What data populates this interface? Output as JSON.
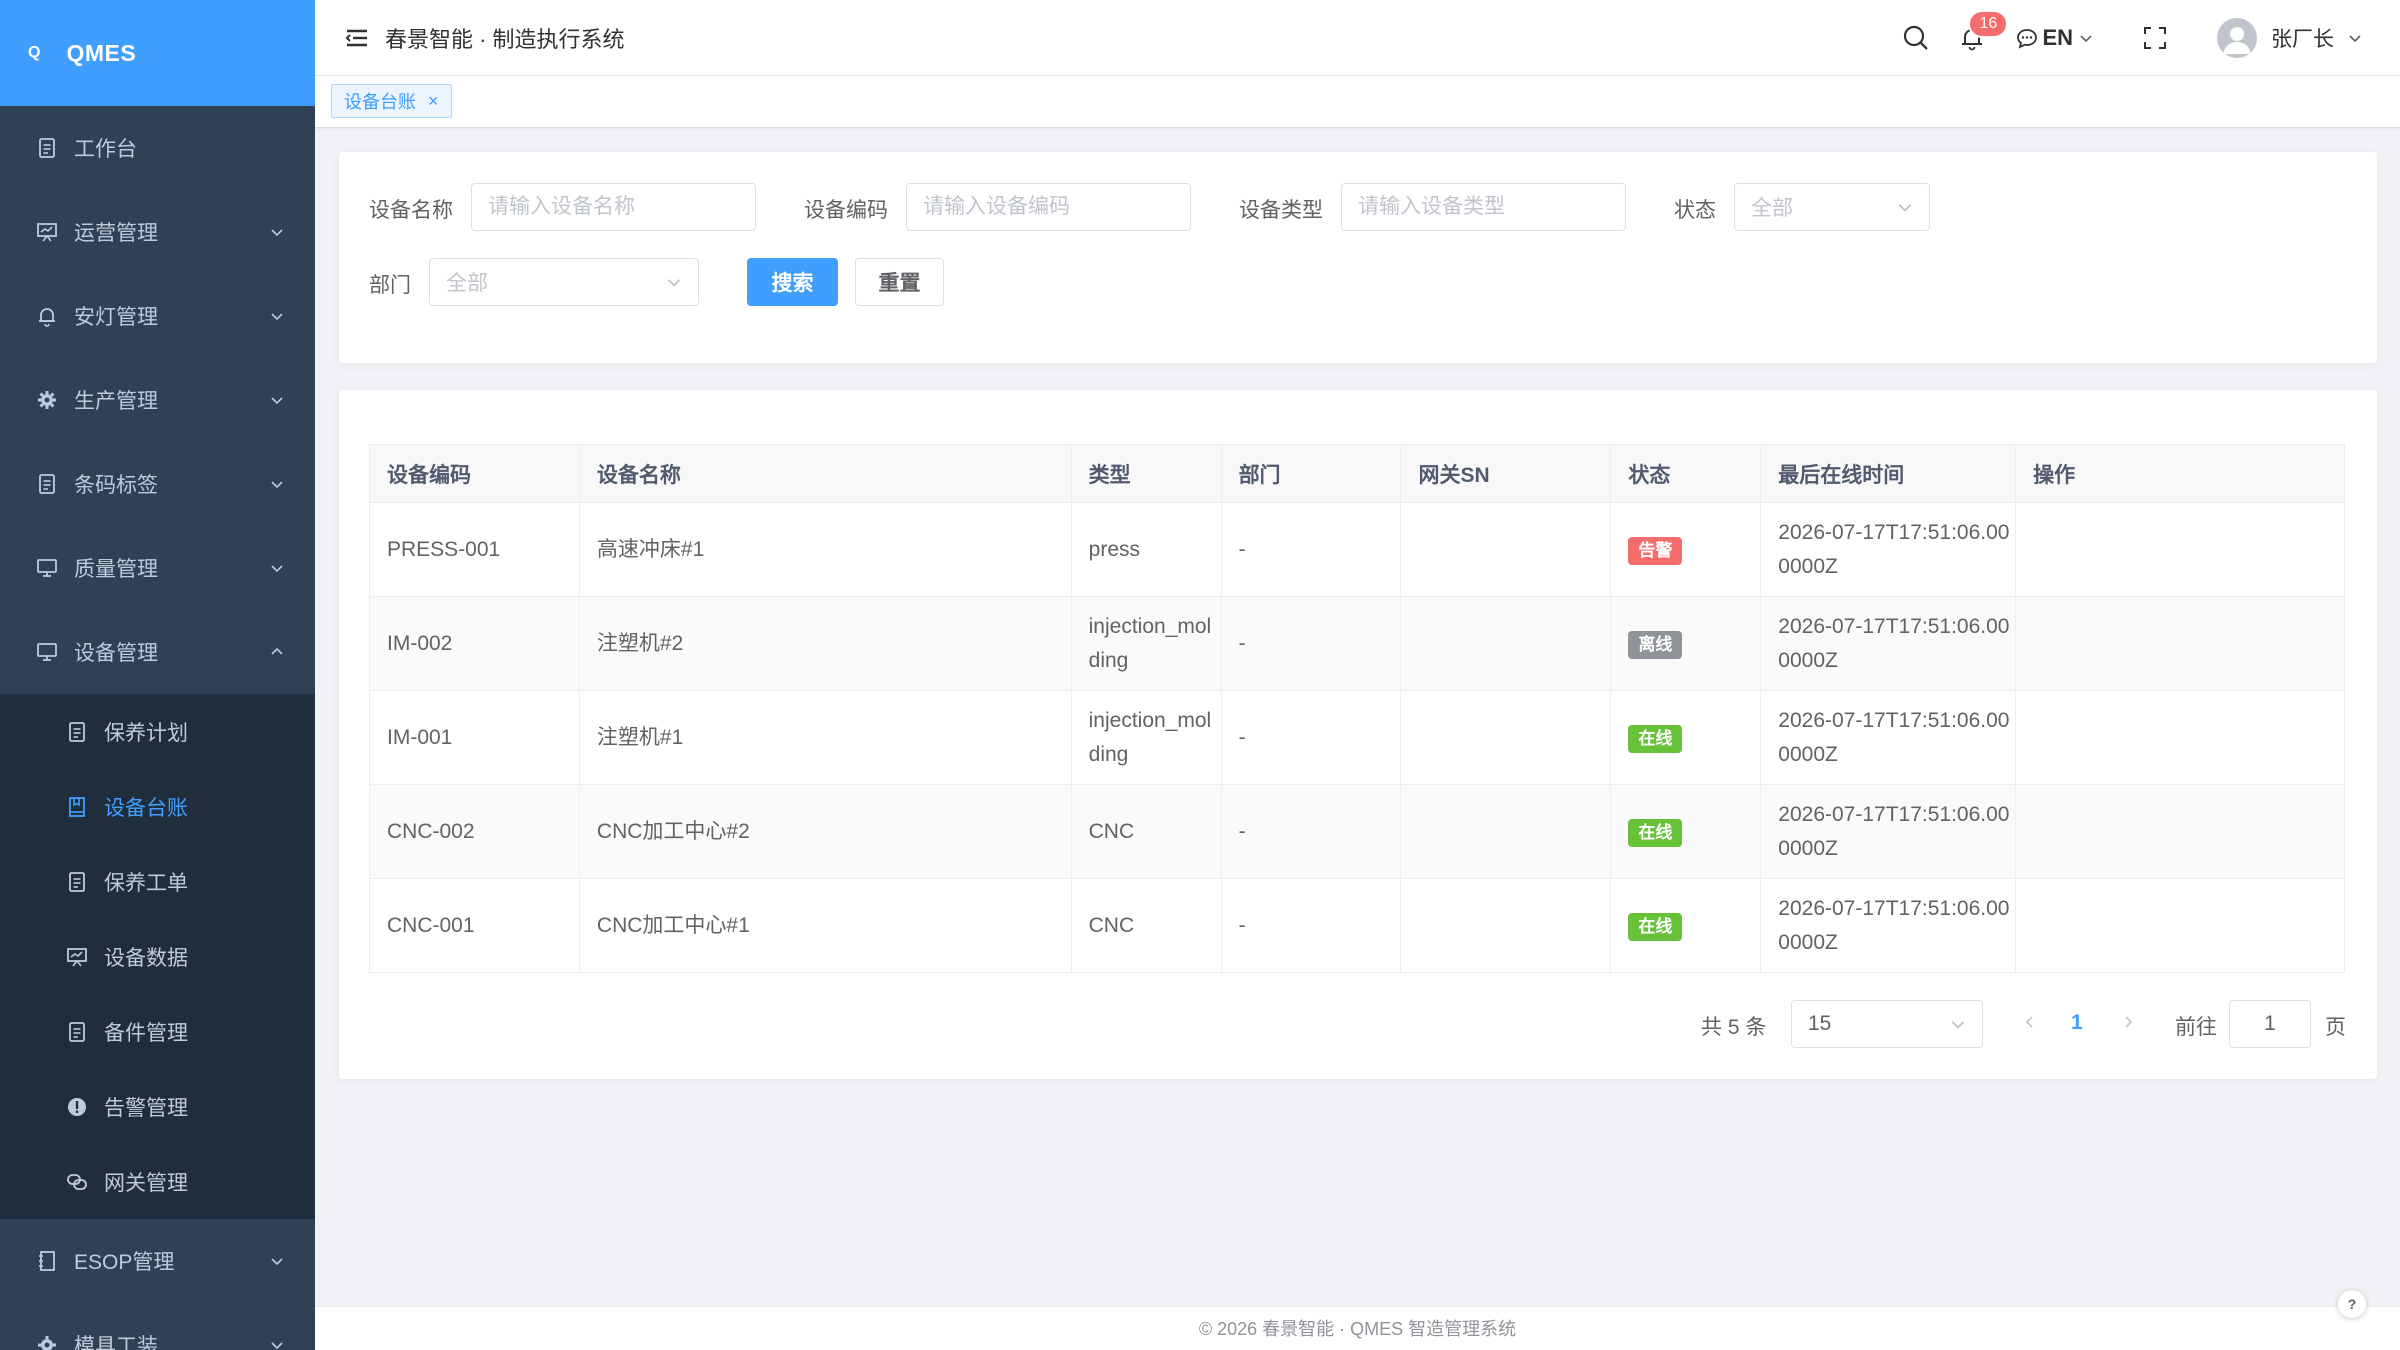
{
  "logo": {
    "mark": "Q",
    "text": "QMES"
  },
  "sidebar": {
    "items": [
      {
        "label": "工作台",
        "icon": "document-icon"
      },
      {
        "label": "运营管理",
        "icon": "presentation-icon"
      },
      {
        "label": "安灯管理",
        "icon": "bell-icon"
      },
      {
        "label": "生产管理",
        "icon": "gear-icon"
      },
      {
        "label": "条码标签",
        "icon": "document-icon"
      },
      {
        "label": "质量管理",
        "icon": "monitor-icon"
      },
      {
        "label": "设备管理",
        "icon": "monitor-icon"
      },
      {
        "label": "ESOP管理",
        "icon": "notebook-icon"
      },
      {
        "label": "模具工装",
        "icon": "gear-icon"
      }
    ],
    "sub_items": [
      {
        "label": "保养计划",
        "icon": "document-icon"
      },
      {
        "label": "设备台账",
        "icon": "notebook-icon"
      },
      {
        "label": "保养工单",
        "icon": "document-icon"
      },
      {
        "label": "设备数据",
        "icon": "presentation-icon"
      },
      {
        "label": "备件管理",
        "icon": "document-icon"
      },
      {
        "label": "告警管理",
        "icon": "warning-icon"
      },
      {
        "label": "网关管理",
        "icon": "link-icon"
      }
    ]
  },
  "header": {
    "title": "春景智能 · 制造执行系统",
    "notification_count": "16",
    "lang": "EN",
    "user_name": "张厂长"
  },
  "tags": {
    "active": "设备台账",
    "close": "×"
  },
  "search": {
    "name_label": "设备名称",
    "name_placeholder": "请输入设备名称",
    "code_label": "设备编码",
    "code_placeholder": "请输入设备编码",
    "type_label": "设备类型",
    "type_placeholder": "请输入设备类型",
    "status_label": "状态",
    "status_value": "全部",
    "dept_label": "部门",
    "dept_value": "全部",
    "search_btn": "搜索",
    "reset_btn": "重置"
  },
  "table": {
    "headers": [
      "设备编码",
      "设备名称",
      "类型",
      "部门",
      "网关SN",
      "状态",
      "最后在线时间",
      "操作"
    ],
    "rows": [
      {
        "code": "PRESS-001",
        "name": "高速冲床#1",
        "type": "press",
        "dept": "-",
        "sn": "",
        "status": "告警",
        "status_color": "#f56c6c",
        "last_online": "2026-07-17T17:51:06.000000Z"
      },
      {
        "code": "IM-002",
        "name": "注塑机#2",
        "type": "injection_molding",
        "dept": "-",
        "sn": "",
        "status": "离线",
        "status_color": "#909399",
        "last_online": "2026-07-17T17:51:06.000000Z"
      },
      {
        "code": "IM-001",
        "name": "注塑机#1",
        "type": "injection_molding",
        "dept": "-",
        "sn": "",
        "status": "在线",
        "status_color": "#67c23a",
        "last_online": "2026-07-17T17:51:06.000000Z"
      },
      {
        "code": "CNC-002",
        "name": "CNC加工中心#2",
        "type": "CNC",
        "dept": "-",
        "sn": "",
        "status": "在线",
        "status_color": "#67c23a",
        "last_online": "2026-07-17T17:51:06.000000Z"
      },
      {
        "code": "CNC-001",
        "name": "CNC加工中心#1",
        "type": "CNC",
        "dept": "-",
        "sn": "",
        "status": "在线",
        "status_color": "#67c23a",
        "last_online": "2026-07-17T17:51:06.000000Z"
      }
    ]
  },
  "pagination": {
    "total": "共 5 条",
    "page_size": "15",
    "current": "1",
    "goto_label": "前往",
    "goto_value": "1",
    "page_suffix": "页"
  },
  "footer": {
    "text": "© 2026 春景智能 · QMES 智造管理系统"
  },
  "help": {
    "label": "?"
  },
  "colors": {
    "sidebar_bg": "#304156",
    "accent": "#409eff"
  }
}
